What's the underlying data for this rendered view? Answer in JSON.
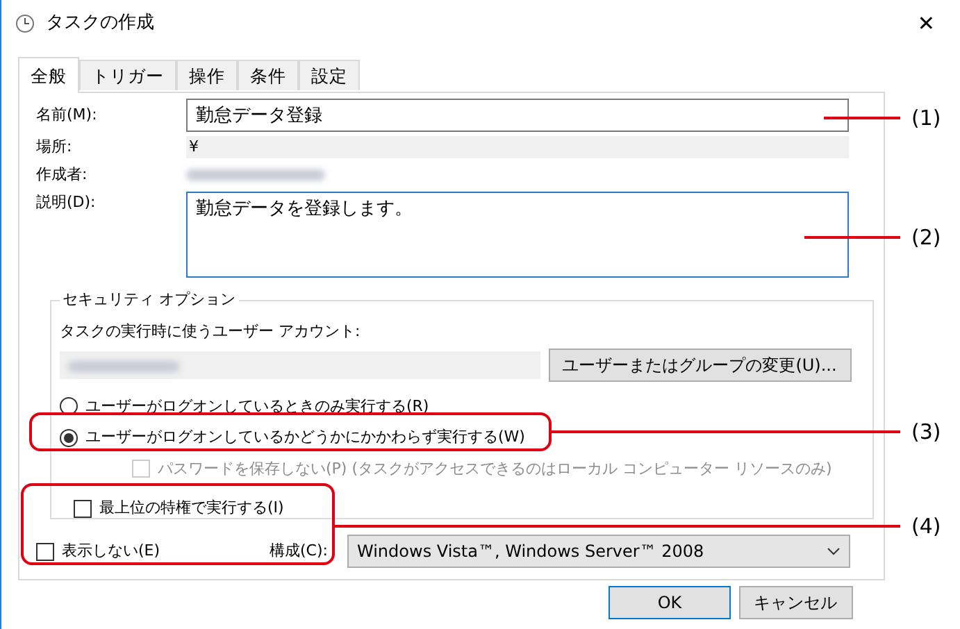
{
  "window": {
    "title": "タスクの作成",
    "close": "✕"
  },
  "tabs": [
    {
      "label": "全般",
      "selected": true
    },
    {
      "label": "トリガー",
      "selected": false
    },
    {
      "label": "操作",
      "selected": false
    },
    {
      "label": "条件",
      "selected": false
    },
    {
      "label": "設定",
      "selected": false
    }
  ],
  "general": {
    "name_label": "名前(M):",
    "name_value": "勤怠データ登録",
    "location_label": "場所:",
    "location_value": "¥",
    "author_label": "作成者:",
    "author_value": {
      "kind": "redacted"
    },
    "description_label": "説明(D):",
    "description_value": "勤怠データを登録します。"
  },
  "security": {
    "title": "セキュリティ オプション",
    "account_label": "タスクの実行時に使うユーザー アカウント:",
    "account_value": {
      "kind": "redacted"
    },
    "change_button": "ユーザーまたはグループの変更(U)...",
    "radios": [
      {
        "label": "ユーザーがログオンしているときのみ実行する(R)",
        "selected": false
      },
      {
        "label": "ユーザーがログオンしているかどうかにかかわらず実行する(W)",
        "selected": true
      }
    ],
    "no_password": {
      "label": "パスワードを保存しない(P) (タスクがアクセスできるのはローカル コンピューター リソースのみ)",
      "checked": false,
      "disabled": true
    },
    "highest": {
      "label": "最上位の特権で実行する(I)",
      "checked": false,
      "disabled": false
    }
  },
  "hidden": {
    "label": "表示しない(E)",
    "checked": false,
    "disabled": false
  },
  "configure": {
    "label": "構成(C):",
    "value": "Windows Vista™, Windows Server™ 2008"
  },
  "buttons": [
    "OK",
    "キャンセル"
  ],
  "annotations": [
    {
      "label": "(1)"
    },
    {
      "label": "(2)"
    },
    {
      "label": "(3)"
    },
    {
      "label": "(4)"
    }
  ]
}
